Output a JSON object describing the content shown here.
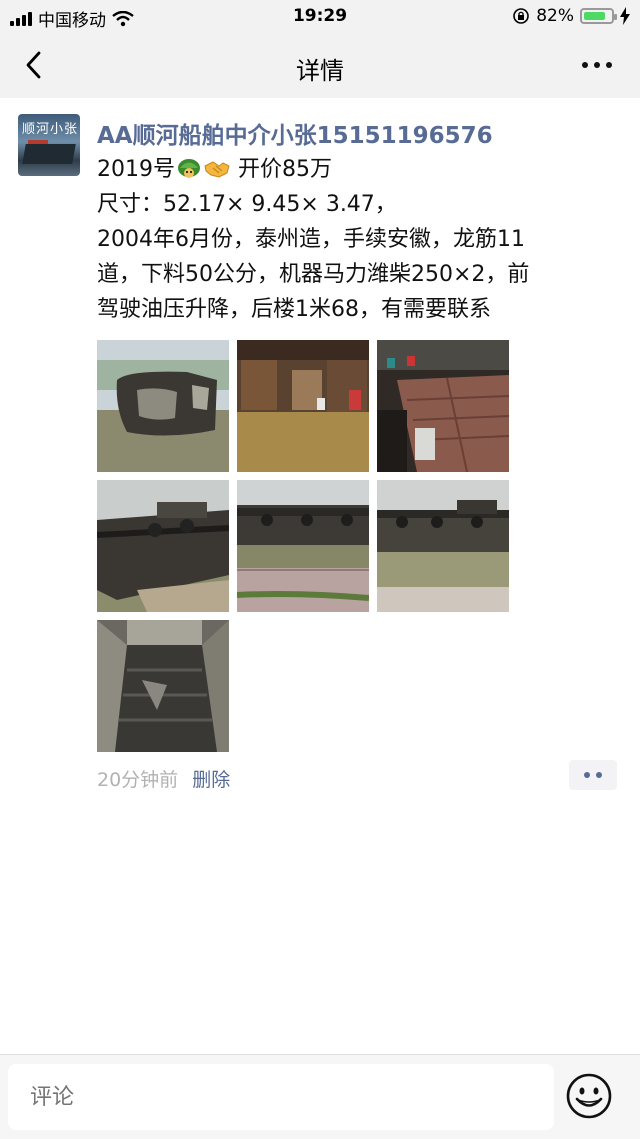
{
  "status_bar": {
    "carrier": "中国移动",
    "time": "19:29",
    "battery_percent": "82%",
    "battery_level": 0.82
  },
  "nav": {
    "title": "详情"
  },
  "post": {
    "author": "AA顺河船舶中介小张15151196576",
    "avatar_text": "顺河小张",
    "line1_prefix": "2019号",
    "line1_suffix": " 开价85万",
    "line2": "尺寸：52.17× 9.45× 3.47，",
    "line3": "2004年6月份，泰州造，手续安徽，龙筋11",
    "line4": "道，下料50公分，机器马力潍柴250×2，前",
    "line5": "驾驶油压升降，后楼1米68，有需要联系",
    "emojis": [
      "turtle-icon",
      "handshake-icon"
    ],
    "photos": [
      {
        "name": "photo-ship-hull-front"
      },
      {
        "name": "photo-cabin-interior"
      },
      {
        "name": "photo-deck-hatch"
      },
      {
        "name": "photo-ship-side-left"
      },
      {
        "name": "photo-ship-side-middle"
      },
      {
        "name": "photo-ship-side-right"
      },
      {
        "name": "photo-cargo-hold"
      }
    ],
    "time_ago": "20分钟前",
    "delete_label": "删除"
  },
  "comment_bar": {
    "placeholder": "评论"
  },
  "colors": {
    "link": "#576b95",
    "battery": "#4cd964"
  }
}
